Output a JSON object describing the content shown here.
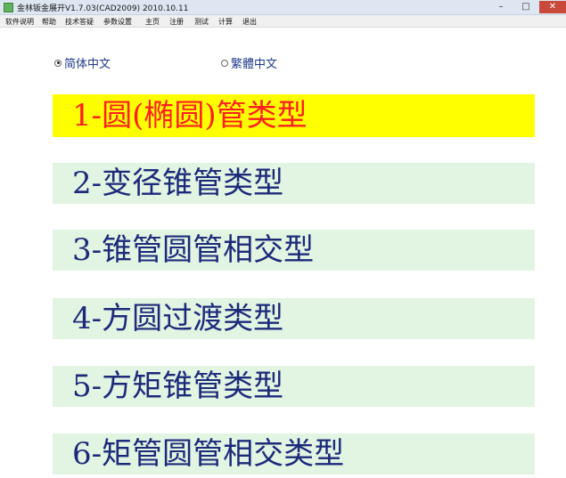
{
  "window": {
    "title": "金林钣金展开V1.7.03(CAD2009)      2010.10.11",
    "minimize": "–",
    "maximize": "□",
    "close": "✕"
  },
  "menu": [
    "软件说明",
    "帮助",
    "技术答疑",
    "参数设置",
    "主页",
    "注册",
    "测试",
    "计算",
    "退出"
  ],
  "language": {
    "simplified": "简体中文",
    "traditional": "繁體中文",
    "selected": "simplified"
  },
  "types": [
    {
      "label": "1-圆(椭圆)管类型",
      "active": true
    },
    {
      "label": "2-变径锥管类型",
      "active": false
    },
    {
      "label": "3-锥管圆管相交型",
      "active": false
    },
    {
      "label": "4-方圆过渡类型",
      "active": false
    },
    {
      "label": "5-方矩锥管类型",
      "active": false
    },
    {
      "label": "6-矩管圆管相交类型",
      "active": false
    }
  ],
  "colors": {
    "active_bg": "#ffff00",
    "active_text": "#ff1f1f",
    "button_bg": "#e2f4e2",
    "button_text": "#1c2a7a"
  }
}
